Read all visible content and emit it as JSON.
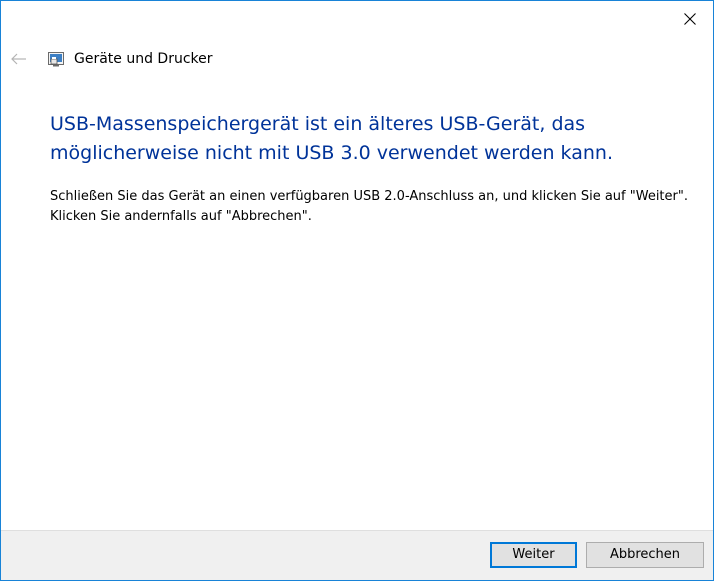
{
  "window": {
    "app_title": "Geräte und Drucker"
  },
  "content": {
    "heading": "USB-Massenspeichergerät ist ein älteres USB-Gerät, das möglicherweise nicht mit USB 3.0 verwendet werden kann.",
    "body": "Schließen Sie das Gerät an einen verfügbaren USB 2.0-Anschluss an, und klicken Sie auf \"Weiter\". Klicken Sie andernfalls auf \"Abbrechen\"."
  },
  "footer": {
    "next_label": "Weiter",
    "cancel_label": "Abbrechen"
  },
  "icons": {
    "close": "close-icon",
    "back": "back-arrow-icon",
    "app": "devices-printers-icon"
  },
  "colors": {
    "heading": "#003399",
    "window_border": "#1883d7",
    "primary_border": "#0078d7",
    "footer_bg": "#f0f0f0"
  }
}
